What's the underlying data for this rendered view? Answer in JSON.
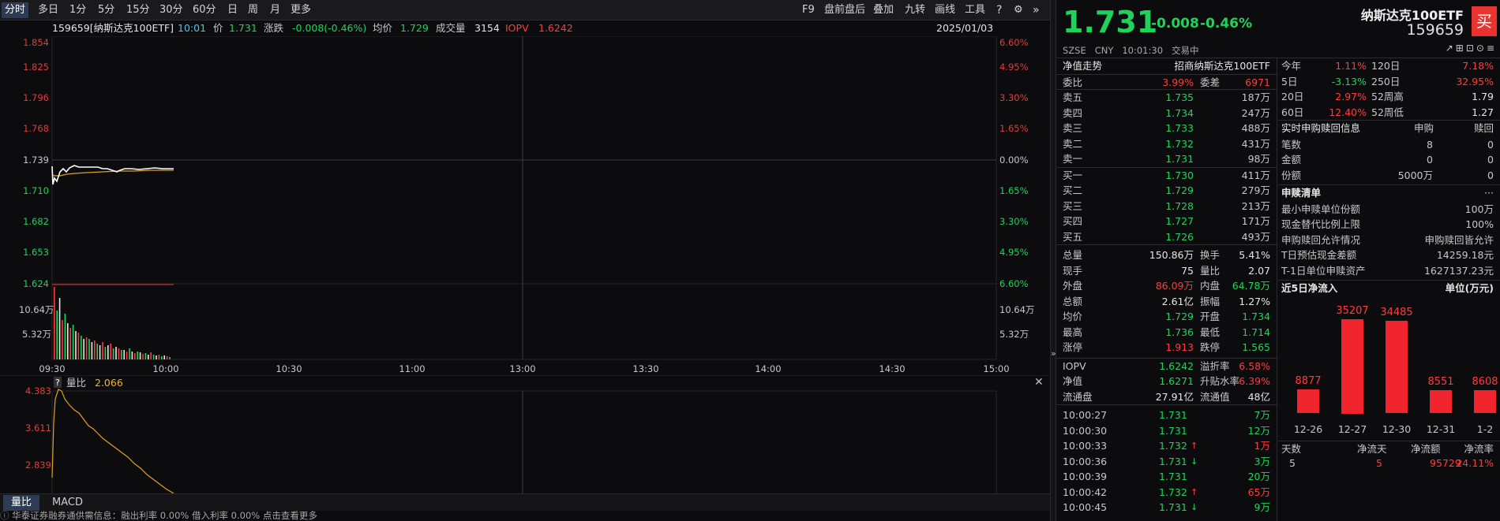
{
  "toolbar": {
    "periods": [
      "分时",
      "多日",
      "1分",
      "5分",
      "15分",
      "30分",
      "60分",
      "日",
      "周",
      "月",
      "更多"
    ],
    "active": "分时",
    "tools": [
      "F9",
      "盘前盘后",
      "叠加",
      "九转",
      "画线",
      "工具"
    ]
  },
  "info": {
    "code_name": "159659[纳斯达克100ETF]",
    "time": "10:01",
    "price_label": "价",
    "price": "1.731",
    "change_label": "涨跌",
    "change": "-0.008(-0.46%)",
    "avg_label": "均价",
    "avg": "1.729",
    "vol_label": "成交量",
    "vol": "3154",
    "iopv_label": "IOPV",
    "iopv": "1.6242",
    "date": "2025/01/03"
  },
  "chart": {
    "y_prices": [
      "1.854",
      "1.825",
      "1.796",
      "1.768",
      "1.739",
      "1.710",
      "1.682",
      "1.653",
      "1.624"
    ],
    "y_pcts": [
      "6.60%",
      "4.95%",
      "3.30%",
      "1.65%",
      "0.00%",
      "1.65%",
      "3.30%",
      "4.95%",
      "6.60%"
    ],
    "vol_left": [
      "10.64万",
      "5.32万"
    ],
    "vol_right": [
      "10.64万",
      "5.32万"
    ],
    "x_times": [
      "09:30",
      "10:00",
      "10:30",
      "11:00",
      "13:00",
      "13:30",
      "14:00",
      "14:30",
      "15:00"
    ]
  },
  "sub": {
    "q": "?",
    "label": "量比",
    "value": "2.066",
    "y_vals": [
      "4.383",
      "3.611",
      "2.839"
    ]
  },
  "subtabs": [
    "量比",
    "MACD"
  ],
  "status": "华泰证券融券通供需信息：融出利率 0.00%  借入利率 0.00%  点击查看更多",
  "quote": {
    "price": "1.731",
    "chg": "-0.008",
    "pct": "-0.46%",
    "name": "纳斯达克100ETF",
    "code": "159659",
    "buy": "买",
    "market": "SZSE",
    "currency": "CNY",
    "time": "10:01:30",
    "state": "交易中",
    "icons": "↗⊞⊡⊙≡"
  },
  "left_panel": {
    "nav_label": "净值走势",
    "fund": "招商纳斯达克100ETF",
    "weibi_label": "委比",
    "weibi": "3.99%",
    "weicha_label": "委差",
    "weicha": "6971",
    "sells": [
      {
        "l": "卖五",
        "p": "1.735",
        "v": "187万"
      },
      {
        "l": "卖四",
        "p": "1.734",
        "v": "247万"
      },
      {
        "l": "卖三",
        "p": "1.733",
        "v": "488万"
      },
      {
        "l": "卖二",
        "p": "1.732",
        "v": "431万"
      },
      {
        "l": "卖一",
        "p": "1.731",
        "v": "98万"
      }
    ],
    "buys": [
      {
        "l": "买一",
        "p": "1.730",
        "v": "411万"
      },
      {
        "l": "买二",
        "p": "1.729",
        "v": "279万"
      },
      {
        "l": "买三",
        "p": "1.728",
        "v": "213万"
      },
      {
        "l": "买四",
        "p": "1.727",
        "v": "171万"
      },
      {
        "l": "买五",
        "p": "1.726",
        "v": "493万"
      }
    ],
    "stats": [
      [
        "总量",
        "150.86万",
        "换手",
        "5.41%"
      ],
      [
        "现手",
        "75",
        "量比",
        "2.07"
      ],
      [
        "外盘",
        "86.09万",
        "内盘",
        "64.78万"
      ],
      [
        "总额",
        "2.61亿",
        "振幅",
        "1.27%"
      ],
      [
        "均价",
        "1.729",
        "开盘",
        "1.734"
      ],
      [
        "最高",
        "1.736",
        "最低",
        "1.714"
      ],
      [
        "涨停",
        "1.913",
        "跌停",
        "1.565"
      ]
    ],
    "nav": [
      [
        "IOPV",
        "1.6242",
        "溢折率",
        "6.58%"
      ],
      [
        "净值",
        "1.6271",
        "升贴水率",
        "6.39%"
      ],
      [
        "流通盘",
        "27.91亿",
        "流通值",
        "48亿"
      ]
    ],
    "ticks": [
      {
        "t": "10:00:27",
        "p": "1.731",
        "a": "",
        "v": "7万"
      },
      {
        "t": "10:00:30",
        "p": "1.731",
        "a": "",
        "v": "12万"
      },
      {
        "t": "10:00:33",
        "p": "1.732",
        "a": "↑",
        "v": "1万"
      },
      {
        "t": "10:00:36",
        "p": "1.731",
        "a": "↓",
        "v": "3万"
      },
      {
        "t": "10:00:39",
        "p": "1.731",
        "a": "",
        "v": "20万"
      },
      {
        "t": "10:00:42",
        "p": "1.732",
        "a": "↑",
        "v": "65万"
      },
      {
        "t": "10:00:45",
        "p": "1.731",
        "a": "↓",
        "v": "9万"
      }
    ]
  },
  "right_panel": {
    "periods": [
      [
        "今年",
        "1.11%",
        "120日",
        "7.18%"
      ],
      [
        "5日",
        "-3.13%",
        "250日",
        "32.95%"
      ],
      [
        "20日",
        "2.97%",
        "52周高",
        "1.79"
      ],
      [
        "60日",
        "12.40%",
        "52周低",
        "1.27"
      ]
    ],
    "sg_title": "实时申购赎回信息",
    "sg_h1": "申购",
    "sg_h2": "赎回",
    "sg_rows": [
      [
        "笔数",
        "8",
        "0"
      ],
      [
        "金额",
        "0",
        "0"
      ],
      [
        "份额",
        "5000万",
        "0"
      ]
    ],
    "list_title": "申赎清单",
    "list_more": "···",
    "list_rows": [
      [
        "最小申赎单位份额",
        "100万"
      ],
      [
        "现金替代比例上限",
        "100%"
      ],
      [
        "申购赎回允许情况",
        "申购赎回皆允许"
      ],
      [
        "T日预估现金差额",
        "14259.18元"
      ],
      [
        "T-1日单位申赎资产",
        "1627137.23元"
      ]
    ],
    "flow_title": "近5日净流入",
    "flow_unit": "单位(万元)",
    "flow": {
      "categories": [
        "12-26",
        "12-27",
        "12-30",
        "12-31",
        "1-2"
      ],
      "values": [
        8877,
        35207,
        34485,
        8551,
        8608
      ]
    },
    "foot_h": [
      "天数",
      "净流天",
      "净流额",
      "净流率"
    ],
    "foot_v": [
      "5",
      "5",
      "95729",
      "24.11%"
    ]
  }
}
